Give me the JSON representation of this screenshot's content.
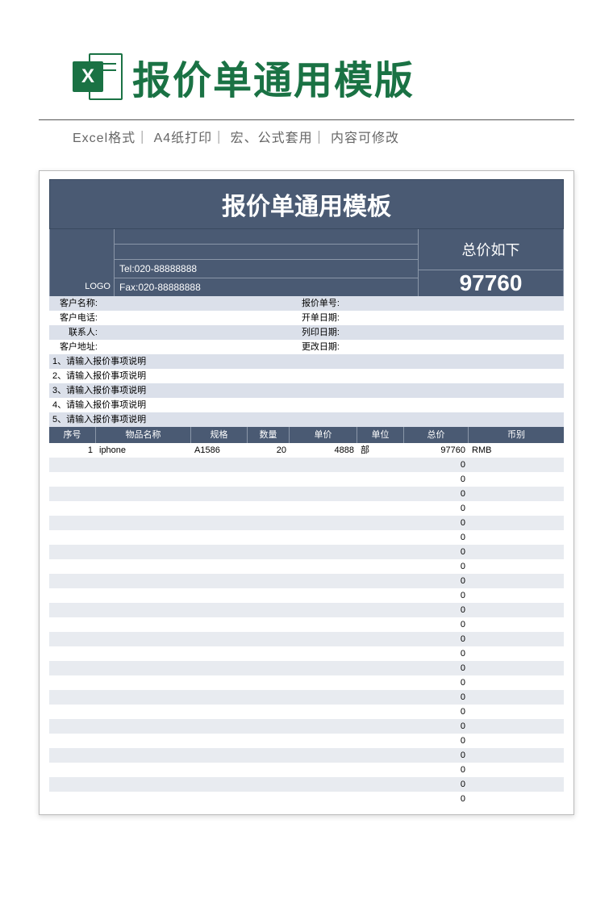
{
  "hero": {
    "title": "报价单通用模版",
    "meta": "Excel格式｜ A4纸打印｜ 宏、公式套用｜ 内容可修改"
  },
  "doc": {
    "header_title": "报价单通用模板",
    "logo_label": "LOGO",
    "tel_line": "Tel:020-88888888",
    "fax_line": "Fax:020-88888888",
    "total_label": "总价如下",
    "total_value": "97760",
    "fields_left": [
      "客户名称:",
      "客户电话:",
      "联系人:",
      "客户地址:"
    ],
    "fields_right": [
      "报价单号:",
      "开单日期:",
      "列印日期:",
      "更改日期:"
    ],
    "instructions": [
      "1、请输入报价事项说明",
      "2、请输入报价事项说明",
      "3、请输入报价事项说明",
      "4、请输入报价事项说明",
      "5、请输入报价事项说明"
    ],
    "item_headers": {
      "seq": "序号",
      "name": "物品名称",
      "spec": "规格",
      "qty": "数量",
      "price": "单价",
      "unit": "单位",
      "total": "总价",
      "cur": "币别"
    },
    "chart_data": {
      "type": "table",
      "columns": [
        "序号",
        "物品名称",
        "规格",
        "数量",
        "单价",
        "单位",
        "总价",
        "币别"
      ],
      "rows": [
        {
          "seq": "1",
          "name": "iphone",
          "spec": "A1586",
          "qty": "20",
          "price": "4888",
          "unit": "部",
          "total": "97760",
          "cur": "RMB"
        },
        {
          "seq": "",
          "name": "",
          "spec": "",
          "qty": "",
          "price": "",
          "unit": "",
          "total": "0",
          "cur": ""
        },
        {
          "seq": "",
          "name": "",
          "spec": "",
          "qty": "",
          "price": "",
          "unit": "",
          "total": "0",
          "cur": ""
        },
        {
          "seq": "",
          "name": "",
          "spec": "",
          "qty": "",
          "price": "",
          "unit": "",
          "total": "0",
          "cur": ""
        },
        {
          "seq": "",
          "name": "",
          "spec": "",
          "qty": "",
          "price": "",
          "unit": "",
          "total": "0",
          "cur": ""
        },
        {
          "seq": "",
          "name": "",
          "spec": "",
          "qty": "",
          "price": "",
          "unit": "",
          "total": "0",
          "cur": ""
        },
        {
          "seq": "",
          "name": "",
          "spec": "",
          "qty": "",
          "price": "",
          "unit": "",
          "total": "0",
          "cur": ""
        },
        {
          "seq": "",
          "name": "",
          "spec": "",
          "qty": "",
          "price": "",
          "unit": "",
          "total": "0",
          "cur": ""
        },
        {
          "seq": "",
          "name": "",
          "spec": "",
          "qty": "",
          "price": "",
          "unit": "",
          "total": "0",
          "cur": ""
        },
        {
          "seq": "",
          "name": "",
          "spec": "",
          "qty": "",
          "price": "",
          "unit": "",
          "total": "0",
          "cur": ""
        },
        {
          "seq": "",
          "name": "",
          "spec": "",
          "qty": "",
          "price": "",
          "unit": "",
          "total": "0",
          "cur": ""
        },
        {
          "seq": "",
          "name": "",
          "spec": "",
          "qty": "",
          "price": "",
          "unit": "",
          "total": "0",
          "cur": ""
        },
        {
          "seq": "",
          "name": "",
          "spec": "",
          "qty": "",
          "price": "",
          "unit": "",
          "total": "0",
          "cur": ""
        },
        {
          "seq": "",
          "name": "",
          "spec": "",
          "qty": "",
          "price": "",
          "unit": "",
          "total": "0",
          "cur": ""
        },
        {
          "seq": "",
          "name": "",
          "spec": "",
          "qty": "",
          "price": "",
          "unit": "",
          "total": "0",
          "cur": ""
        },
        {
          "seq": "",
          "name": "",
          "spec": "",
          "qty": "",
          "price": "",
          "unit": "",
          "total": "0",
          "cur": ""
        },
        {
          "seq": "",
          "name": "",
          "spec": "",
          "qty": "",
          "price": "",
          "unit": "",
          "total": "0",
          "cur": ""
        },
        {
          "seq": "",
          "name": "",
          "spec": "",
          "qty": "",
          "price": "",
          "unit": "",
          "total": "0",
          "cur": ""
        },
        {
          "seq": "",
          "name": "",
          "spec": "",
          "qty": "",
          "price": "",
          "unit": "",
          "total": "0",
          "cur": ""
        },
        {
          "seq": "",
          "name": "",
          "spec": "",
          "qty": "",
          "price": "",
          "unit": "",
          "total": "0",
          "cur": ""
        },
        {
          "seq": "",
          "name": "",
          "spec": "",
          "qty": "",
          "price": "",
          "unit": "",
          "total": "0",
          "cur": ""
        },
        {
          "seq": "",
          "name": "",
          "spec": "",
          "qty": "",
          "price": "",
          "unit": "",
          "total": "0",
          "cur": ""
        },
        {
          "seq": "",
          "name": "",
          "spec": "",
          "qty": "",
          "price": "",
          "unit": "",
          "total": "0",
          "cur": ""
        },
        {
          "seq": "",
          "name": "",
          "spec": "",
          "qty": "",
          "price": "",
          "unit": "",
          "total": "0",
          "cur": ""
        },
        {
          "seq": "",
          "name": "",
          "spec": "",
          "qty": "",
          "price": "",
          "unit": "",
          "total": "0",
          "cur": ""
        }
      ]
    }
  }
}
